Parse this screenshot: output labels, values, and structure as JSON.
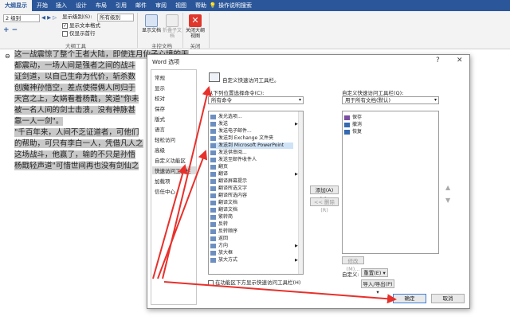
{
  "tabs": [
    "大纲显示",
    "开始",
    "插入",
    "设计",
    "布局",
    "引用",
    "邮件",
    "审阅",
    "视图",
    "帮助",
    "操作说明搜索"
  ],
  "ribbon": {
    "level_select": "2 级别",
    "show_level_label": "显示级别(S):",
    "show_level_value": "所有级别",
    "show_text_format": "显示文本格式",
    "show_first_line": "仅显示首行",
    "group_outline_tools": "大纲工具",
    "btn_show_doc": "显示文档",
    "btn_collapse_subdoc": "折叠子文档",
    "group_master_doc": "主控文档",
    "btn_close_outline": "关闭大纲视图",
    "group_close": "关闭"
  },
  "document": {
    "lines": [
      "这一战震惊了整个王者大陆，即使连月仙子心境的天",
      "都震动，一场人间是强者之间的战斗",
      "证剑道，以自己生命为代价，斩杀数",
      "创魔神孙悟空，差点使得俩人同归于",
      "天宫之上，女娲看着杨戬，笑道\"你未",
      "被一名人间的剑士击溃，没有神脉甚",
      "靠一人一剑\"。",
      "\"千百年来，人间不乏证道者，可他们",
      "的帮助，可只有李白一人，凭借凡人之",
      "这场战斗，他赢了，输的不只是孙悟",
      "杨戬轻声道\"可惜世间再也没有剑仙之"
    ]
  },
  "dialog": {
    "title": "Word 选项",
    "help": "?",
    "close": "✕",
    "nav": [
      "常规",
      "显示",
      "校对",
      "保存",
      "版式",
      "语言",
      "轻松访问",
      "高级",
      "自定义功能区",
      "快速访问工具栏",
      "加载项",
      "信任中心"
    ],
    "nav_selected": 9,
    "heading": "自定义快速访问工具栏。",
    "choose_from_label": "从下列位置选择命令(C):",
    "choose_from_value": "所有命令",
    "customize_label": "自定义快速访问工具栏(Q):",
    "customize_value": "用于所有文档(默认)",
    "commands": [
      "发光选项...",
      "发送",
      "发送电子邮件...",
      "发送到 Exchange 文件夹",
      "发送到 Microsoft PowerPoint",
      "发送供审阅...",
      "发送至邮件收件人",
      "翻页",
      "翻译",
      "翻译屏幕提示",
      "翻译所选文字",
      "翻译所选内容",
      "翻译文档",
      "翻译文档",
      "繁转简",
      "反转",
      "反转顺序",
      "返回",
      "方向",
      "放大框",
      "放大方式"
    ],
    "highlighted_index": 4,
    "qat_items": [
      "保存",
      "撤消",
      "恢复"
    ],
    "add_btn": "添加(A) >>",
    "remove_btn": "<< 删除(R)",
    "modify_btn": "修改(M)...",
    "custom_label": "自定义:",
    "reset_btn": "重置(E) ▾",
    "import_btn": "导入/导出(P) ▾",
    "show_below_ribbon": "在功能区下方显示快速访问工具栏(H)",
    "ok_btn": "确定",
    "cancel_btn": "取消"
  }
}
